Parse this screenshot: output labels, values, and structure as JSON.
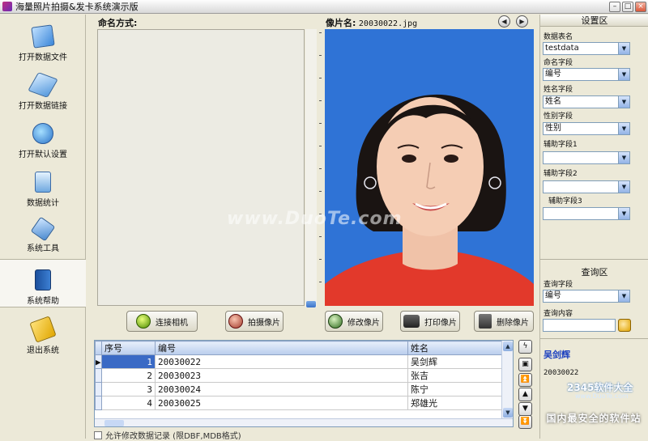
{
  "window": {
    "title": "海量照片拍摄&发卡系统演示版",
    "min": "–",
    "max": "□",
    "close": "×"
  },
  "sidebar": {
    "items": [
      {
        "label": "打开数据文件",
        "icon": "open-data-file-icon"
      },
      {
        "label": "打开数据链接",
        "icon": "open-data-link-icon"
      },
      {
        "label": "打开默认设置",
        "icon": "open-default-settings-icon"
      },
      {
        "label": "数据统计",
        "icon": "data-statistics-icon"
      },
      {
        "label": "系统工具",
        "icon": "system-tools-icon"
      },
      {
        "label": "系统帮助",
        "icon": "system-help-icon"
      },
      {
        "label": "退出系统",
        "icon": "exit-system-icon"
      }
    ]
  },
  "naming": {
    "label": "命名方式:"
  },
  "photo": {
    "label_key": "像片名:",
    "filename": "20030022.jpg",
    "prev": "◀",
    "next": "▶"
  },
  "watermark": "www.DuoTe.com",
  "actions": {
    "connect_camera": "连接相机",
    "take_photo": "拍摄像片",
    "edit_photo": "修改像片",
    "print_photo": "打印像片",
    "delete_photo": "删除像片"
  },
  "table": {
    "columns": [
      "序号",
      "编号",
      "姓名"
    ],
    "rows": [
      {
        "seq": "1",
        "id": "20030022",
        "name": "吴剑辉"
      },
      {
        "seq": "2",
        "id": "20030023",
        "name": "张吉"
      },
      {
        "seq": "3",
        "id": "20030024",
        "name": "陈宁"
      },
      {
        "seq": "4",
        "id": "20030025",
        "name": "郑雄光"
      }
    ]
  },
  "allow_edit": "允许修改数据记录 (限DBF,MDB格式)",
  "settings": {
    "title": "设置区",
    "table_name_label": "数据表名",
    "table_name_value": "testdata",
    "name_field_label": "命名字段",
    "name_field_value": "编号",
    "person_field_label": "姓名字段",
    "person_field_value": "姓名",
    "gender_field_label": "性别字段",
    "gender_field_value": "性别",
    "aux1_label": "辅助字段1",
    "aux1_value": "",
    "aux2_label": "辅助字段2",
    "aux2_value": "",
    "aux3_label": "辅助字段3",
    "aux3_value": ""
  },
  "query": {
    "title": "查询区",
    "field_label": "查询字段",
    "field_value": "编号",
    "content_label": "查询内容",
    "content_value": ""
  },
  "selected": {
    "name": "吴剑辉",
    "id": "20030022"
  },
  "branding": {
    "logo": "2345软件大全",
    "url": "www.DuoTe.com",
    "footer": "国内最安全的软件站"
  },
  "colors": {
    "photo_bg": "#3279d8",
    "selection": "#3a6ac5",
    "name_link": "#1a3fbf"
  }
}
